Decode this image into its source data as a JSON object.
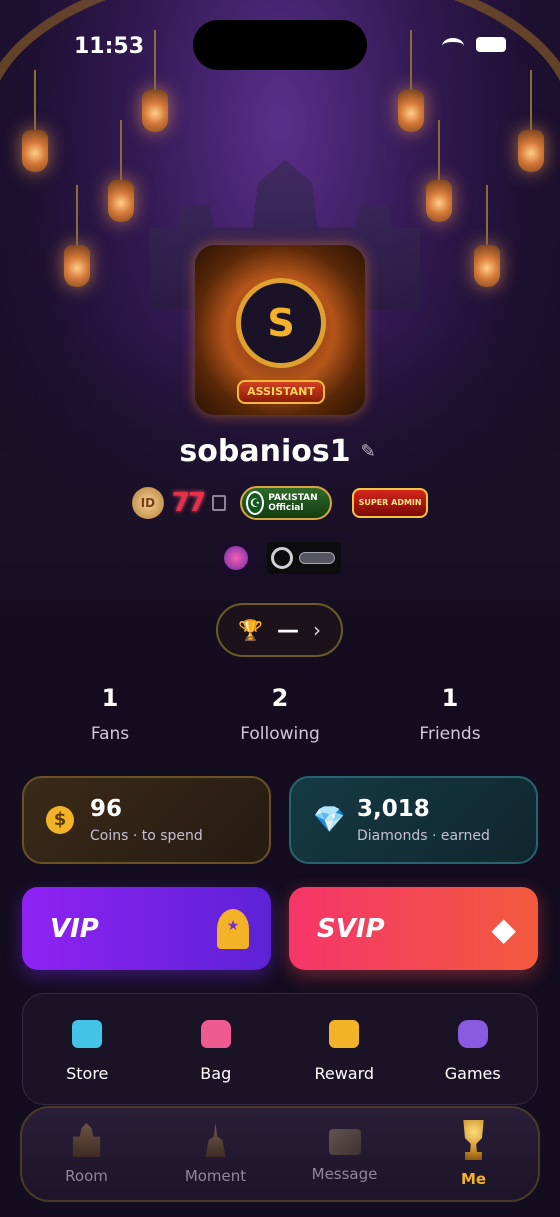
{
  "status_bar": {
    "time": "11:53"
  },
  "profile": {
    "avatar_letter": "S",
    "frame_label": "ASSISTANT",
    "username": "sobanios1",
    "id_badge": "ID",
    "id_number": "77",
    "pakistan_badge": "PAKISTAN Official",
    "role_badge": "SUPER ADMIN"
  },
  "trophy": {
    "value": "—"
  },
  "stats": [
    {
      "value": "1",
      "label": "Fans"
    },
    {
      "value": "2",
      "label": "Following"
    },
    {
      "value": "1",
      "label": "Friends"
    }
  ],
  "wallet": {
    "coins": {
      "value": "96",
      "label": "Coins · to spend"
    },
    "diamonds": {
      "value": "3,018",
      "label": "Diamonds · earned"
    }
  },
  "membership": {
    "vip": "VIP",
    "svip": "SVIP"
  },
  "quick_actions": [
    {
      "label": "Store",
      "icon": "store-icon"
    },
    {
      "label": "Bag",
      "icon": "bag-icon"
    },
    {
      "label": "Reward",
      "icon": "reward-icon"
    },
    {
      "label": "Games",
      "icon": "gamepad-icon"
    }
  ],
  "bottom_nav": [
    {
      "label": "Room",
      "icon": "room-icon",
      "active": false
    },
    {
      "label": "Moment",
      "icon": "moment-icon",
      "active": false
    },
    {
      "label": "Message",
      "icon": "message-icon",
      "active": false
    },
    {
      "label": "Me",
      "icon": "trophy-icon",
      "active": true
    }
  ],
  "colors": {
    "accent_gold": "#f3b328",
    "vip_purple": "#8f22f3",
    "svip_red": "#f5356a",
    "diamond_cyan": "#38d6e8",
    "background": "#140d1f"
  }
}
